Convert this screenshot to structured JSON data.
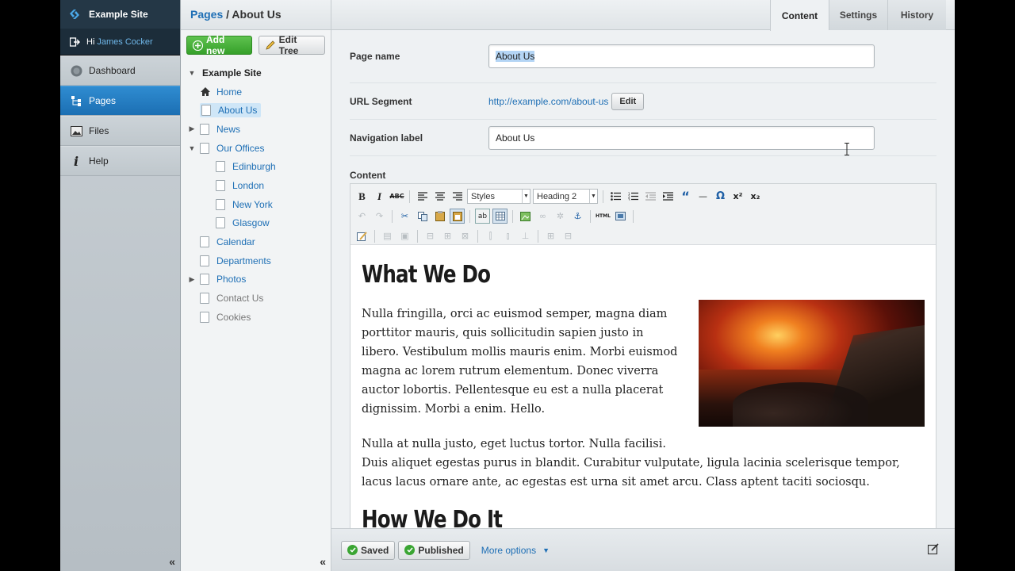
{
  "brand": {
    "name": "Example Site"
  },
  "user": {
    "greeting": "Hi",
    "name": "James Cocker"
  },
  "menu": {
    "items": [
      {
        "label": "Dashboard",
        "icon": "dashboard-icon"
      },
      {
        "label": "Pages",
        "icon": "pages-icon",
        "active": true
      },
      {
        "label": "Files",
        "icon": "image-icon"
      },
      {
        "label": "Help",
        "icon": "info-icon"
      }
    ],
    "collapse": "«"
  },
  "breadcrumb": {
    "parent": "Pages",
    "separator": " / ",
    "current": "About Us"
  },
  "tree_actions": {
    "add_new": "Add new",
    "edit_tree": "Edit Tree"
  },
  "tree": {
    "root": "Example Site",
    "items": [
      {
        "label": "Home"
      },
      {
        "label": "About Us"
      },
      {
        "label": "News"
      },
      {
        "label": "Our Offices"
      },
      {
        "label": "Edinburgh"
      },
      {
        "label": "London"
      },
      {
        "label": "New York"
      },
      {
        "label": "Glasgow"
      },
      {
        "label": "Calendar"
      },
      {
        "label": "Departments"
      },
      {
        "label": "Photos"
      },
      {
        "label": "Contact Us"
      },
      {
        "label": "Cookies"
      }
    ],
    "collapse": "«"
  },
  "tabs": [
    "Content",
    "Settings",
    "History"
  ],
  "form": {
    "page_name_label": "Page name",
    "page_name_value": "About Us",
    "url_label": "URL Segment",
    "url_value": "http://example.com/about-us",
    "url_edit": "Edit",
    "nav_label": "Navigation label",
    "nav_value": "About Us",
    "content_label": "Content"
  },
  "toolbar": {
    "styles": "Styles",
    "format": "Heading 2"
  },
  "document": {
    "heading1": "What We Do",
    "para1": "Nulla fringilla, orci ac euismod semper, magna diam porttitor mauris, quis sollicitudin sapien justo in libero. Vestibulum mollis mauris enim. Morbi euismod magna ac lorem rutrum elementum. Donec viverra auctor lobortis. Pellentesque eu est a nulla placerat dignissim. Morbi a enim. Hello.",
    "para2_line1": "Nulla at nulla justo, eget luctus tortor. Nulla facilisi.",
    "para2_line2": "Duis aliquet egestas purus in blandit. Curabitur vulputate, ligula lacinia scelerisque tempor, lacus lacus ornare ante, ac egestas est urna sit amet arcu. Class aptent taciti sociosqu.",
    "heading2": "How We Do It"
  },
  "footer": {
    "saved": "Saved",
    "published": "Published",
    "more_options": "More options"
  }
}
